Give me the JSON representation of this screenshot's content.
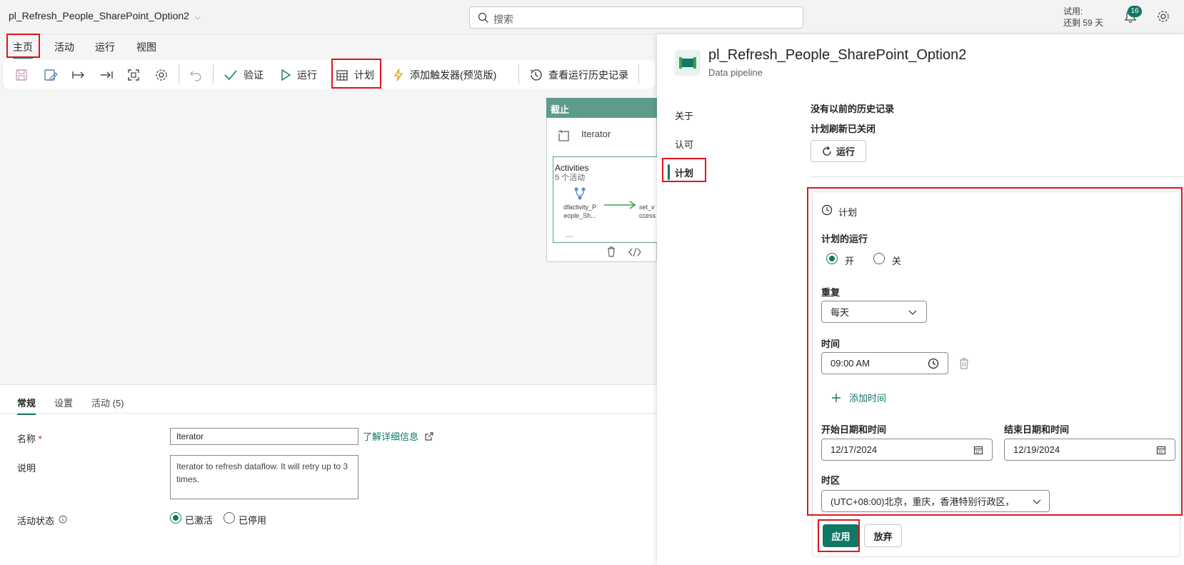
{
  "app": {
    "title": "pl_Refresh_People_SharePoint_Option2"
  },
  "search": {
    "placeholder": "搜索"
  },
  "trial": {
    "line1": "试用:",
    "line2": "还剩 59 天"
  },
  "notifications": {
    "count": "16"
  },
  "main_tabs": [
    {
      "label": "主页"
    },
    {
      "label": "活动"
    },
    {
      "label": "运行"
    },
    {
      "label": "视图"
    }
  ],
  "toolbar": {
    "validate": "验证",
    "run": "运行",
    "schedule": "计划",
    "add_trigger": "添加触发器(预览版)",
    "view_history": "查看运行历史记录"
  },
  "canvas": {
    "card_header": "截止",
    "activity_name": "Iterator",
    "activities_title": "Activities",
    "activities_count": "5 个活动",
    "node1": "dfactivity_P eople_Sh...",
    "node2": "set_v ccess",
    "ellipsis": "..."
  },
  "bottom_tabs": [
    {
      "label": "常规"
    },
    {
      "label": "设置"
    },
    {
      "label": "活动 (5)"
    }
  ],
  "general": {
    "name_label": "名称",
    "name_required": "*",
    "name_value": "Iterator",
    "learn_more": "了解详细信息",
    "desc_label": "说明",
    "desc_value": "Iterator to refresh dataflow. It will retry up to 3 times.",
    "state_label": "活动状态",
    "state_active": "已激活",
    "state_inactive": "已停用"
  },
  "panel": {
    "title": "pl_Refresh_People_SharePoint_Option2",
    "subtitle": "Data pipeline",
    "nav": [
      {
        "label": "关于"
      },
      {
        "label": "认可"
      },
      {
        "label": "计划"
      }
    ],
    "no_history": "没有以前的历史记录",
    "refresh_off": "计划刷新已关闭",
    "run_button": "运行",
    "schedule_header": "计划",
    "scheduled_run_label": "计划的运行",
    "on": "开",
    "off": "关",
    "repeat_label": "重复",
    "repeat_value": "每天",
    "time_label": "时间",
    "time_value": "09:00 AM",
    "add_time": "添加时间",
    "start_label": "开始日期和时间",
    "start_value": "12/17/2024",
    "end_label": "结束日期和时间",
    "end_value": "12/19/2024",
    "timezone_label": "时区",
    "timezone_value": "(UTC+08:00)北京，重庆，香港特别行政区，",
    "apply": "应用",
    "discard": "放弃"
  },
  "colors": {
    "accent": "#117865",
    "highlight": "#e0141e"
  }
}
